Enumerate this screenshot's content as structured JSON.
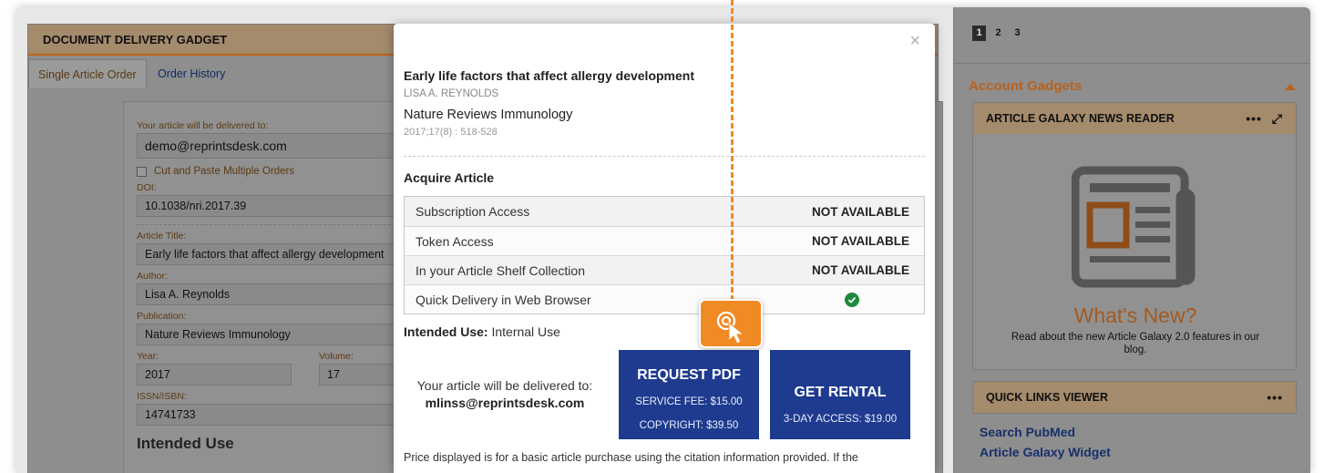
{
  "gadget": {
    "title": "DOCUMENT DELIVERY GADGET",
    "tabs": [
      {
        "label": "Single Article Order",
        "active": true
      },
      {
        "label": "Order History",
        "active": false
      }
    ],
    "form": {
      "delivered_label": "Your article will be delivered to:",
      "delivered_value": "demo@reprintsdesk.com",
      "cut_paste_label": "Cut and Paste Multiple Orders",
      "doi_label": "DOI:",
      "doi_value": "10.1038/nri.2017.39",
      "title_label": "Article Title:",
      "title_value": "Early life factors that affect allergy development",
      "author_label": "Author:",
      "author_value": "Lisa A. Reynolds",
      "publication_label": "Publication:",
      "publication_value": "Nature Reviews Immunology",
      "year_label": "Year:",
      "year_value": "2017",
      "volume_label": "Volume:",
      "volume_value": "17",
      "issn_label": "ISSN/ISBN:",
      "issn_value": "14741733",
      "intended_heading": "Intended Use"
    }
  },
  "sidebar": {
    "pages": [
      "1",
      "2",
      "3"
    ],
    "active_page": "1",
    "account_title": "Account Gadgets",
    "news": {
      "title": "ARTICLE GALAXY NEWS READER",
      "controls": "•••",
      "whats_new": "What's New?",
      "blurb": "Read about the new Article Galaxy 2.0 features in our blog."
    },
    "quick_links": {
      "title": "QUICK LINKS VIEWER",
      "controls": "•••",
      "links": [
        "Search PubMed",
        "Article Galaxy Widget"
      ]
    }
  },
  "modal": {
    "close": "×",
    "article_title": "Early life factors that affect allergy development",
    "author": "LISA A. REYNOLDS",
    "journal": "Nature Reviews Immunology",
    "citation": "2017;17(8) : 518-528",
    "acquire_heading": "Acquire Article",
    "access_rows": [
      {
        "label": "Subscription Access",
        "status": "NOT AVAILABLE"
      },
      {
        "label": "Token Access",
        "status": "NOT AVAILABLE"
      },
      {
        "label": "In your Article Shelf Collection",
        "status": "NOT AVAILABLE"
      },
      {
        "label": "Quick Delivery in Web Browser",
        "status": "available"
      }
    ],
    "intended_label": "Intended Use:",
    "intended_value": "Internal Use",
    "deliver_label": "Your article will be delivered to:",
    "deliver_email": "mlinss@reprintsdesk.com",
    "request_pdf": {
      "title": "REQUEST PDF",
      "fee": "SERVICE FEE: $15.00",
      "copyright": "COPYRIGHT: $39.50"
    },
    "rental": {
      "title": "GET RENTAL",
      "access": "3-DAY ACCESS: $19.00"
    },
    "price_note": "Price displayed is for a basic article purchase using the citation information provided. If the"
  },
  "colors": {
    "accent_orange": "#f08a24",
    "button_blue": "#1e3b8f",
    "header_tan": "#a48b6c",
    "ok_green": "#1d8a3a"
  }
}
